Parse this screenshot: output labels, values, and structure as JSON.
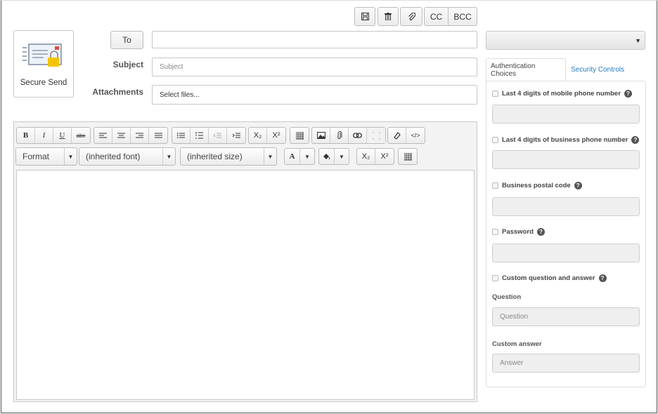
{
  "toolbar_top": {
    "save_icon": "floppy-icon",
    "delete_icon": "trash-icon",
    "attach_icon": "paperclip-icon",
    "cc_label": "CC",
    "bcc_label": "BCC"
  },
  "secure_send": {
    "label": "Secure Send",
    "icon": "envelope-lock-icon"
  },
  "form": {
    "to_label": "To",
    "to_value": "",
    "subject_label": "Subject",
    "subject_placeholder": "Subject",
    "attachments_label": "Attachments",
    "attachments_value": "Select files..."
  },
  "editor": {
    "bold": "B",
    "italic": "I",
    "underline": "U",
    "strike": "abc",
    "format_label": "Format",
    "font_label": "(inherited font)",
    "size_label": "(inherited size)",
    "font_color_label": "A",
    "sub_label": "X₂",
    "sup_label": "X²",
    "body_text": ""
  },
  "sidebar": {
    "select_value": "",
    "tabs": [
      {
        "label": "Authentication Choices",
        "active": true
      },
      {
        "label": "Security Controls",
        "active": false
      }
    ],
    "choices": [
      {
        "label": "Last 4 digits of mobile phone number",
        "value": ""
      },
      {
        "label": "Last 4 digits of business phone number",
        "value": ""
      },
      {
        "label": "Business postal code",
        "value": ""
      },
      {
        "label": "Password",
        "value": ""
      }
    ],
    "custom_qa_label": "Custom question and answer",
    "question_label": "Question",
    "question_placeholder": "Question",
    "answer_label": "Custom answer",
    "answer_placeholder": "Answer"
  },
  "colors": {
    "link": "#2a7ab8",
    "accent_lock": "#f5c400",
    "accent_stamp": "#e04a3a"
  }
}
